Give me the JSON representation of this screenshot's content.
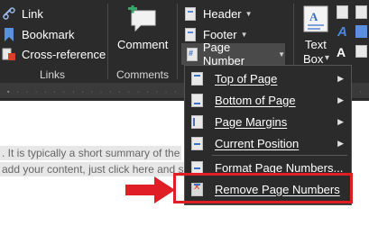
{
  "ribbon": {
    "links_group": {
      "label": "Links",
      "items": [
        {
          "label": "Link",
          "icon": "link-icon"
        },
        {
          "label": "Bookmark",
          "icon": "bookmark-icon"
        },
        {
          "label": "Cross-reference",
          "icon": "cross-reference-icon"
        }
      ]
    },
    "comments_group": {
      "label": "Comments",
      "comment_label": "Comment",
      "icon": "new-comment-icon"
    },
    "header_footer": {
      "header_label": "Header",
      "footer_label": "Footer",
      "page_number_label": "Page Number"
    },
    "text_box": {
      "line1": "Text",
      "line2": "Box",
      "caret": "▾"
    }
  },
  "document": {
    "line1": ". It is typically a short summary of the",
    "line2": "add your content, just click here and s"
  },
  "menu": {
    "items": [
      {
        "label": "Top of Page",
        "submenu": true
      },
      {
        "label": "Bottom of Page",
        "submenu": true
      },
      {
        "label": "Page Margins",
        "submenu": true
      },
      {
        "label": "Current Position",
        "submenu": true
      },
      {
        "label": "Format Page Numbers...",
        "submenu": false
      },
      {
        "label": "Remove Page Numbers",
        "submenu": false
      }
    ]
  },
  "colors": {
    "ribbon_bg": "#2b2b2b",
    "menu_bg": "#2b2b2b",
    "highlight": "#e01e26",
    "accent_blue": "#3f6fc1"
  }
}
